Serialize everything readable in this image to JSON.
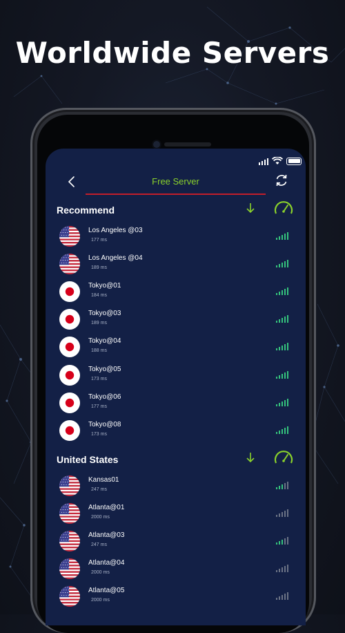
{
  "headline": "Worldwide Servers",
  "colors": {
    "accent": "#8bd22b",
    "underline": "#c31e2a",
    "screen_bg": "#132046",
    "signal_good": "#35c47d",
    "signal_weak": "#6b7385"
  },
  "topbar": {
    "title": "Free Server",
    "back_icon": "chevron-left-icon",
    "refresh_icon": "refresh-icon"
  },
  "sections": [
    {
      "label": "Recommend",
      "servers": [
        {
          "flag": "us",
          "name": "Los Angeles @03",
          "latency": "177 ms",
          "signal": 5
        },
        {
          "flag": "us",
          "name": "Los Angeles @04",
          "latency": "189 ms",
          "signal": 5
        },
        {
          "flag": "jp",
          "name": "Tokyo@01",
          "latency": "184 ms",
          "signal": 5
        },
        {
          "flag": "jp",
          "name": "Tokyo@03",
          "latency": "189 ms",
          "signal": 5
        },
        {
          "flag": "jp",
          "name": "Tokyo@04",
          "latency": "188 ms",
          "signal": 5
        },
        {
          "flag": "jp",
          "name": "Tokyo@05",
          "latency": "173 ms",
          "signal": 5
        },
        {
          "flag": "jp",
          "name": "Tokyo@06",
          "latency": "177 ms",
          "signal": 5
        },
        {
          "flag": "jp",
          "name": "Tokyo@08",
          "latency": "173 ms",
          "signal": 5
        }
      ]
    },
    {
      "label": "United States",
      "servers": [
        {
          "flag": "us",
          "name": "Kansas01",
          "latency": "247 ms",
          "signal": 3
        },
        {
          "flag": "us",
          "name": "Atlanta@01",
          "latency": "2000 ms",
          "signal": 0
        },
        {
          "flag": "us",
          "name": "Atlanta@03",
          "latency": "247 ms",
          "signal": 3
        },
        {
          "flag": "us",
          "name": "Atlanta@04",
          "latency": "2000 ms",
          "signal": 0
        },
        {
          "flag": "us",
          "name": "Atlanta@05",
          "latency": "2000 ms",
          "signal": 0
        }
      ]
    }
  ]
}
